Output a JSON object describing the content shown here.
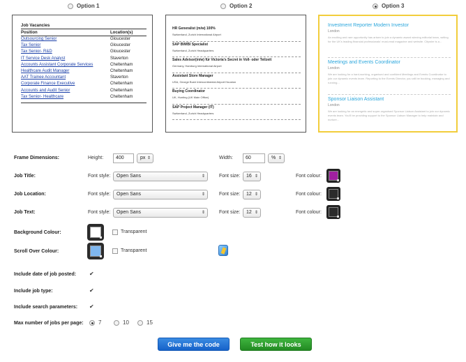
{
  "options": [
    {
      "label": "Option 1",
      "selected": false
    },
    {
      "label": "Option 2",
      "selected": false
    },
    {
      "label": "Option 3",
      "selected": true
    }
  ],
  "preview1": {
    "heading": "Job Vacancies",
    "col_position": "Position",
    "col_location": "Location(s)",
    "rows": [
      {
        "title": "Outsourcing Senior",
        "location": "Gloucester"
      },
      {
        "title": "Tax Senior",
        "location": "Gloucester"
      },
      {
        "title": "Tax Senior- R&D",
        "location": "Gloucester"
      },
      {
        "title": "IT Service Desk Analyst",
        "location": "Staverton"
      },
      {
        "title": "Accounts Assistant Corporate Services",
        "location": "Cheltenham"
      },
      {
        "title": "Healthcare Audit Manager",
        "location": "Cheltenham"
      },
      {
        "title": "AAT Trainee Accountant",
        "location": "Staverton"
      },
      {
        "title": "Corporate Finance Executive",
        "location": "Cheltenham"
      },
      {
        "title": "Accounts and Audit Senior",
        "location": "Cheltenham"
      },
      {
        "title": "Tax Senior- Healthcare",
        "location": "Cheltenham"
      }
    ]
  },
  "preview2": {
    "items": [
      {
        "title": "HR Generalist (m/w) 100%",
        "location": "Switzerland, Zurich International Airport"
      },
      {
        "title": "SAP BW/BI Specialist",
        "location": "Switzerland, Zurich Headquarters"
      },
      {
        "title": "Sales Advisor(in/w) für Victoria's Secret in Voll- oder Teilzeit",
        "location": "Germany, Hamburg International Airport"
      },
      {
        "title": "Assistant Store Manager",
        "location": "USA, George Bush Intercontinental Airport Houston"
      },
      {
        "title": "Buying Coordinator",
        "location": "UK, Hunting (UK Main Office)"
      },
      {
        "title": "SAP Project Manager (IT)",
        "location": "Switzerland, Zurich Headquarters"
      }
    ]
  },
  "preview3": {
    "items": [
      {
        "title": "Investment Reporter Modern Investor",
        "location": "London",
        "text": "An exciting and rare opportunity has arisen to join a dynamic award winning editorial team, writing for the UK's leading financial professionals' must-read magazine and website. Citywire is a..."
      },
      {
        "title": "Meetings and Events Coordinator",
        "location": "London",
        "text": "We are looking for a hard-working, organised and confident Meetings and Events Coordinator to join our dynamic events team. Reporting to the Events Director, you will be booking, managing and running..."
      },
      {
        "title": "Sponsor Liaison Assistant",
        "location": "London",
        "text": "We are looking for an energetic and super-organised Sponsor Liaison Assistant to join our dynamic events team. You'll be providing support to the Sponsor Liaison Manager to help maintain and nurture..."
      }
    ]
  },
  "form": {
    "frame_label": "Frame Dimensions:",
    "height_label": "Height:",
    "height_value": "400",
    "height_unit": "px",
    "width_label": "Width:",
    "width_value": "60",
    "width_unit": "%",
    "font_style_label": "Font style:",
    "font_size_label": "Font size:",
    "font_colour_label": "Font colour:",
    "job_title_label": "Job Title:",
    "job_title_font": "Open Sans",
    "job_title_size": "16",
    "job_title_colour": "#a020a0",
    "job_location_label": "Job Location:",
    "job_location_font": "Open Sans",
    "job_location_size": "12",
    "job_location_colour": "#2b2b2b",
    "job_text_label": "Job Text:",
    "job_text_font": "Open Sans",
    "job_text_size": "12",
    "job_text_colour": "#2b2b2b",
    "bg_label": "Background Colour:",
    "bg_colour": "#ffffff",
    "transparent_label": "Transparent",
    "scroll_label": "Scroll Over Colour:",
    "scroll_colour": "#7fb7ef",
    "date_label": "Include date of job posted:",
    "type_label": "Include job type:",
    "search_label": "Include search parameters:",
    "max_label": "Max number of jobs per page:",
    "max_options": [
      "7",
      "10",
      "15"
    ],
    "max_selected": "7",
    "give_code": "Give me the code",
    "test_look": "Test how it looks"
  }
}
